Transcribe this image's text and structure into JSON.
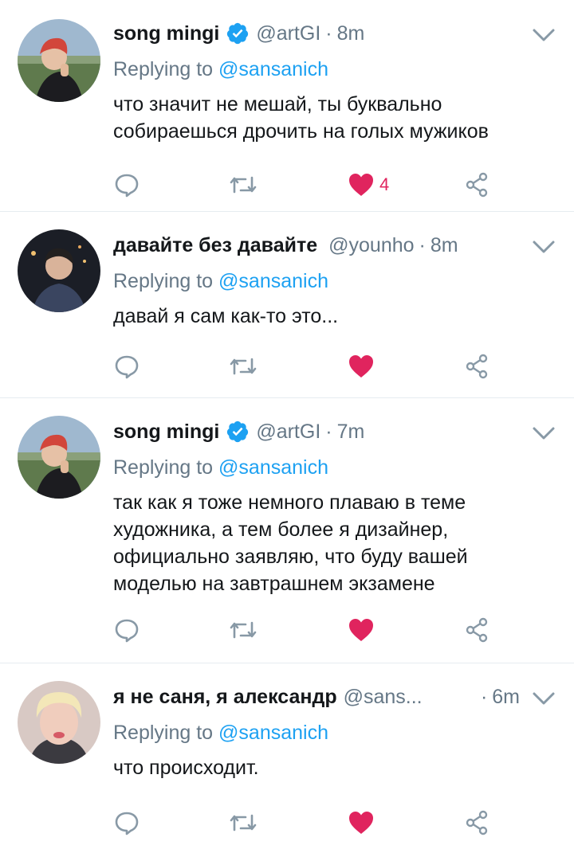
{
  "tweets": [
    {
      "display_name": "song mingi",
      "verified": true,
      "handle": "@artGI",
      "separator": "·",
      "time": "8m",
      "replying_prefix": "Replying to",
      "replying_to": "@sansanich",
      "text": "что значит не мешай, ты буквально собираешься дрочить на голых мужиков",
      "likes": "4",
      "liked": true
    },
    {
      "display_name": "давайте без давайте",
      "verified": false,
      "handle": "@younho",
      "separator": "·",
      "time": "8m",
      "replying_prefix": "Replying to",
      "replying_to": "@sansanich",
      "text": "давай я сам как-то это...",
      "likes": "",
      "liked": true
    },
    {
      "display_name": "song mingi",
      "verified": true,
      "handle": "@artGI",
      "separator": "·",
      "time": "7m",
      "replying_prefix": "Replying to",
      "replying_to": "@sansanich",
      "text": "так как я тоже немного плаваю в теме художника, а тем более я дизайнер, официально заявляю, что буду вашей моделью на завтрашнем экзамене",
      "likes": "",
      "liked": true
    },
    {
      "display_name": "я не саня, я александр",
      "verified": false,
      "handle": "@sans...",
      "separator": "·",
      "time": "6m",
      "replying_prefix": "Replying to",
      "replying_to": "@sansanich",
      "text": "что происходит.",
      "likes": "",
      "liked": true
    }
  ],
  "icons": {
    "reply": "reply-icon",
    "retweet": "retweet-icon",
    "like": "heart-icon",
    "share": "share-icon",
    "verified": "verified-badge-icon",
    "caret": "chevron-down-icon"
  },
  "colors": {
    "text": "#14171a",
    "secondary": "#657786",
    "link": "#1da1f2",
    "like": "#e0245e",
    "divider": "#e6ecf0",
    "verified": "#1da1f2"
  }
}
